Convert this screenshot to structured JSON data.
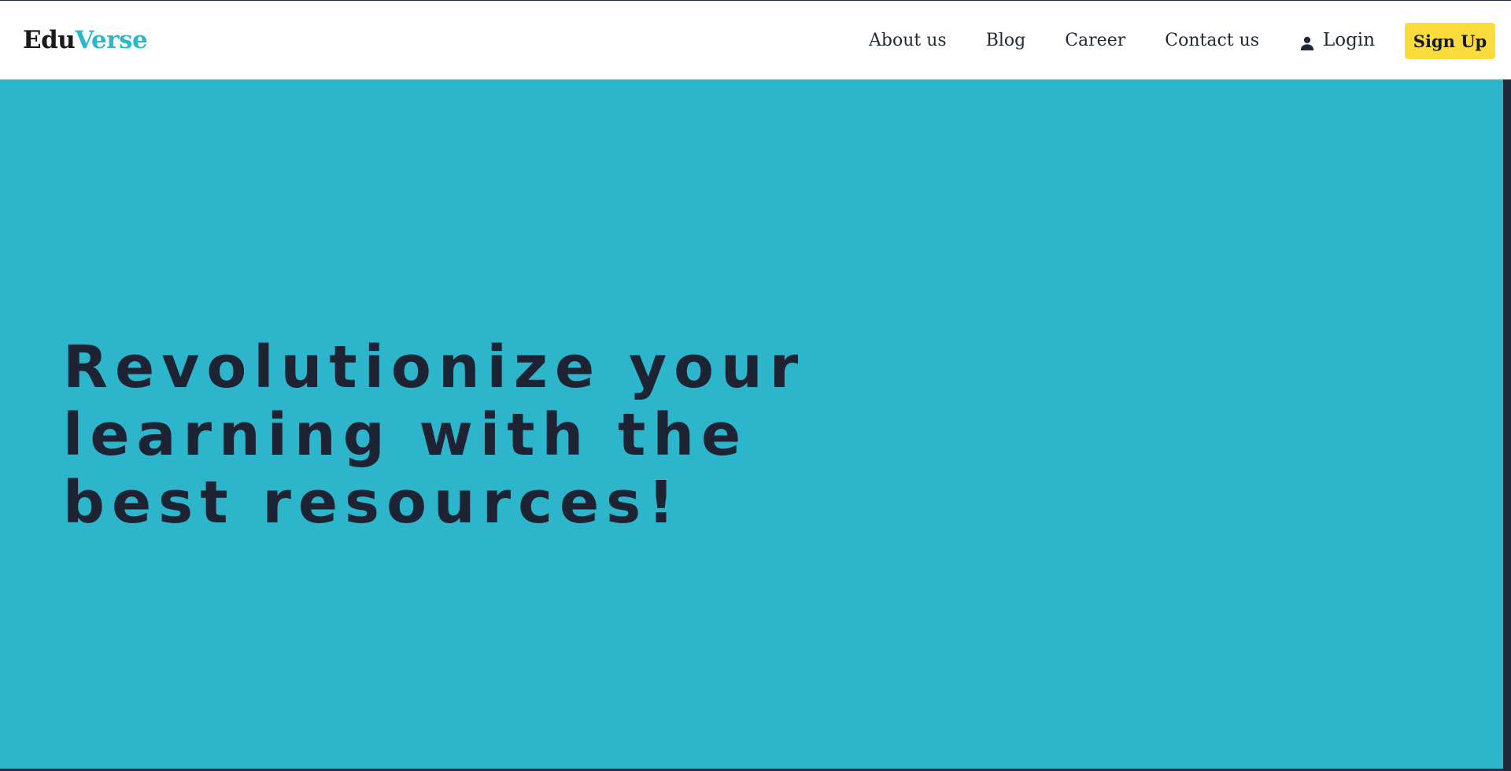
{
  "brand": {
    "name_part_1": "Edu",
    "name_part_2": "Verse",
    "accent_color": "#2eb6cb"
  },
  "nav": {
    "links": [
      {
        "label": "About us"
      },
      {
        "label": "Blog"
      },
      {
        "label": "Career"
      },
      {
        "label": "Contact us"
      }
    ],
    "login": {
      "label": "Login",
      "icon": "person-icon"
    },
    "signup": {
      "label": "Sign Up",
      "color": "#fcdc3c"
    }
  },
  "hero": {
    "title": "Revolutionize your learning with the best resources!",
    "background_color": "#2db6cb",
    "text_color": "#1d2333"
  }
}
